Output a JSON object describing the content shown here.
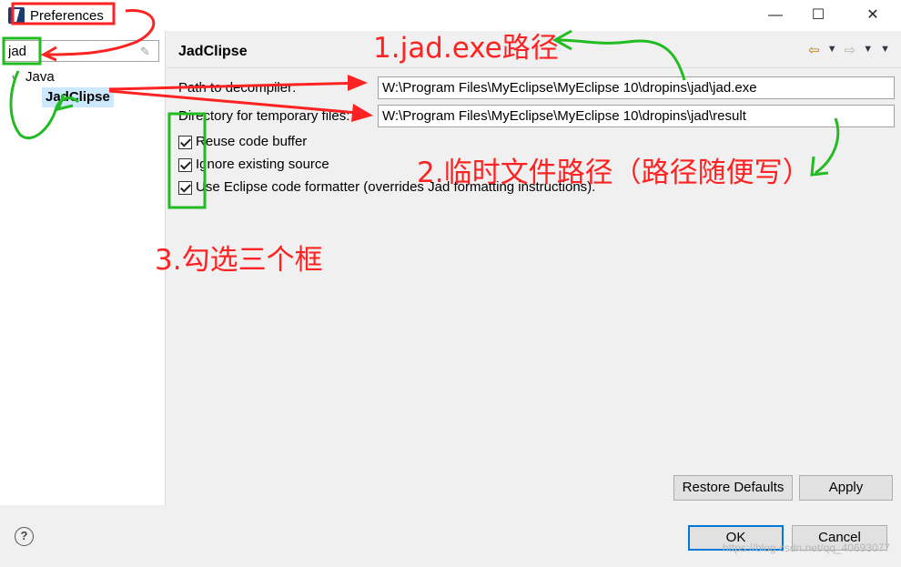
{
  "window": {
    "title": "Preferences",
    "minimize_label": "—",
    "maximize_label": "☐",
    "close_label": "✕"
  },
  "left": {
    "filter_value": "jad",
    "tree": {
      "parent": "Java",
      "child": "JadClipse"
    }
  },
  "page": {
    "title": "JadClipse",
    "fields": [
      {
        "label": "Path to decompiler:",
        "value": "W:\\Program Files\\MyEclipse\\MyEclipse 10\\dropins\\jad\\jad.exe"
      },
      {
        "label": "Directory for temporary files:",
        "value": "W:\\Program Files\\MyEclipse\\MyEclipse 10\\dropins\\jad\\result"
      }
    ],
    "checkboxes": [
      {
        "label": "Reuse code buffer",
        "checked": true
      },
      {
        "label": "Ignore existing source",
        "checked": true
      },
      {
        "label": "Use Eclipse code formatter (overrides Jad formatting instructions).",
        "checked": true
      }
    ],
    "restore_label": "Restore Defaults",
    "apply_label": "Apply"
  },
  "dialog": {
    "ok_label": "OK",
    "cancel_label": "Cancel"
  },
  "annotations": {
    "a1": "1.jad.exe路径",
    "a2": "2.临时文件路径（路径随便写）",
    "a3": "3.勾选三个框"
  },
  "watermark": "https://blog.csdn.net/qq_40693077",
  "colors": {
    "annotation_red": "#ff2222",
    "annotation_green": "#22bb22",
    "selection": "#cce8ff",
    "default_button_border": "#0078d7"
  }
}
